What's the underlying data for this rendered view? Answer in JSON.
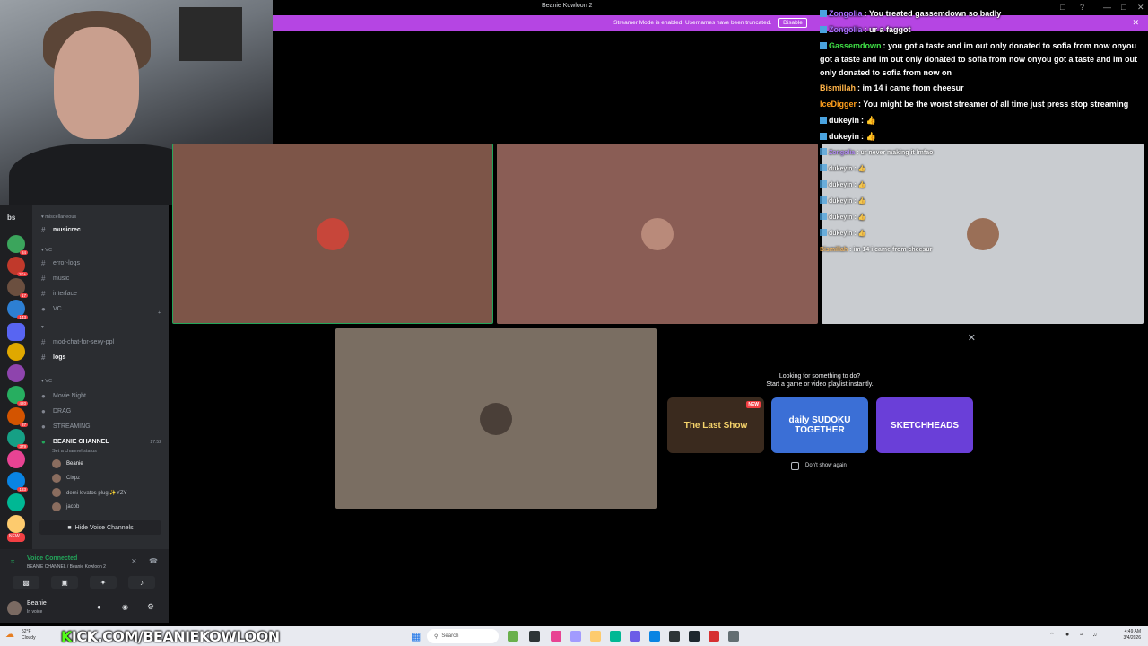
{
  "window": {
    "title": "Beanie Kowloon 2"
  },
  "banner": {
    "text": "Streamer Mode is enabled. Usernames have been truncated.",
    "disable_label": "Disable",
    "color": "#b545e3"
  },
  "server_rail": {
    "label": "bs",
    "badges": [
      "84",
      "1K+",
      "17",
      "143",
      "420",
      "87",
      "379",
      "183",
      "NEW"
    ]
  },
  "channels": {
    "categories": [
      "miscellaneous",
      "VC",
      "-",
      "VC"
    ],
    "items": [
      {
        "name": "musicrec"
      },
      {
        "name": "error-logs"
      },
      {
        "name": "music"
      },
      {
        "name": "interface"
      },
      {
        "name": "VC"
      },
      {
        "name": "mod-chat-for-sexy-ppl"
      },
      {
        "name": "logs"
      },
      {
        "name": "Movie Night"
      },
      {
        "name": "DRAG"
      },
      {
        "name": "STREAMING"
      },
      {
        "name": "BEANIE CHANNEL",
        "timer": "27:52",
        "status": "Set a channel status"
      }
    ],
    "voice_users": [
      "Beanie",
      "Cixpz",
      "demi lovatos plug ✨YZY",
      "jacob"
    ],
    "hide_voice_label": "Hide Voice Channels"
  },
  "voice_panel": {
    "title": "Voice Connected",
    "subtitle": "BEANIE CHANNEL / Beanie Kowloon 2",
    "user": "Beanie",
    "user_status": "In voice"
  },
  "chat": [
    {
      "user": "Zongolia",
      "text": "You treated gassemdown so badly",
      "color": "#a970ff"
    },
    {
      "user": "Zongolia",
      "text": "ur a faggot",
      "color": "#a970ff"
    },
    {
      "user": "Gassemdown",
      "text": "you got a taste and im out only donated to sofia from now onyou got a taste and im out only donated to sofia from now onyou got a taste and im out only donated to sofia from now on",
      "color": "#3fe046"
    },
    {
      "user": "Bismillah",
      "text": "im 14 i came from cheesur",
      "color": "#ffb347"
    },
    {
      "user": "IceDigger",
      "text": "You might be the worst streamer of all time just press stop streaming",
      "color": "#ff9f1c"
    },
    {
      "user": "dukeyin",
      "text": "👍",
      "color": "#ffffff"
    },
    {
      "user": "dukeyin",
      "text": "👍",
      "color": "#ffffff"
    },
    {
      "user": "Zongolia",
      "text": "ur never making it lmfao",
      "color": "#a970ff"
    },
    {
      "user": "dukeyin",
      "text": "👍",
      "color": "#ffffff"
    },
    {
      "user": "dukeyin",
      "text": "👍",
      "color": "#ffffff"
    },
    {
      "user": "dukeyin",
      "text": "👍",
      "color": "#ffffff"
    },
    {
      "user": "dukeyin",
      "text": "👍",
      "color": "#ffffff"
    },
    {
      "user": "dukeyin",
      "text": "👍",
      "color": "#ffffff"
    },
    {
      "user": "Bismillah",
      "text": "im 14 i came from cheesur",
      "color": "#ffb347"
    }
  ],
  "activity": {
    "line1": "Looking for something to do?",
    "line2": "Start a game or video playlist instantly.",
    "games": [
      {
        "name": "The Last Show",
        "tag": "NEW",
        "color": "#3a2a1e"
      },
      {
        "name": "daily SUDOKU TOGETHER",
        "color": "#3b6fd6"
      },
      {
        "name": "SKETCHHEADS",
        "color": "#6a3fd8"
      }
    ],
    "dont_show": "Don't show again"
  },
  "taskbar": {
    "kick_prefix": "K",
    "kick_text": "ICK.COM/BEANIEKOWLOON",
    "search": "Search",
    "weather_temp": "52°F",
    "weather_desc": "Cloudy",
    "time": "4:49 AM",
    "date": "3/4/2026"
  }
}
